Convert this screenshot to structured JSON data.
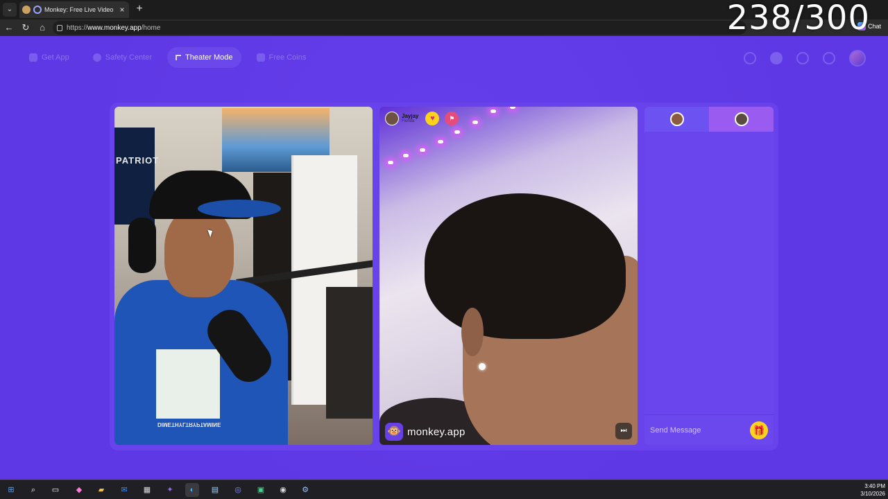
{
  "browser": {
    "tab_title": "Monkey: Free Live Video Chat",
    "tab_close": "×",
    "new_tab": "+",
    "url_prefix": "https://",
    "url_domain": "www.monkey.app",
    "url_path": "/home",
    "chat_button": "Chat"
  },
  "overlay_counter": "238/300",
  "nav": {
    "items": [
      {
        "label": "Get App"
      },
      {
        "label": "Safety Center"
      },
      {
        "label": "Theater Mode"
      },
      {
        "label": "Free Coins"
      }
    ]
  },
  "left_video": {
    "banner_text": "PATRIOT",
    "shirt_text": "DIMETHYLTRYPTAMINE"
  },
  "right_video": {
    "peer_name": "Jayjay",
    "peer_location": "Florida",
    "heart_icon": "♥",
    "flag_icon": "⚑",
    "brand_logo": "🐵",
    "brand_text": "monkey.app",
    "skip_icon": "⏭"
  },
  "chat": {
    "placeholder": "Send Message",
    "gift_icon": "🎁"
  },
  "taskbar": {
    "time": "3:40 PM",
    "date": "3/10/2026"
  },
  "colors": {
    "page_bg": "#5e38e4",
    "accent": "#9a5cf0",
    "gift": "#ffd21c"
  }
}
